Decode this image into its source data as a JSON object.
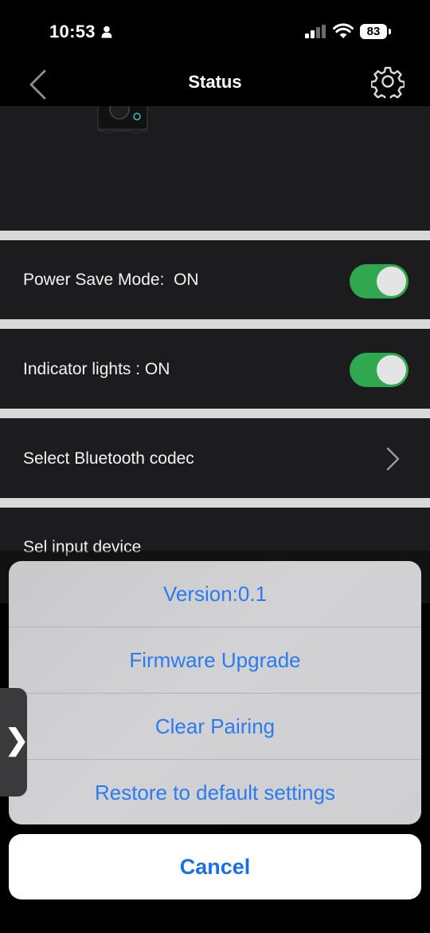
{
  "status_bar": {
    "time": "10:53",
    "battery": "83"
  },
  "nav": {
    "title": "Status"
  },
  "settings": {
    "power_save": {
      "label": "Power Save Mode:  ON",
      "on": true
    },
    "indicator_lights": {
      "label": "Indicator lights : ON",
      "on": true
    },
    "bluetooth_codec": {
      "label": "Select Bluetooth codec"
    },
    "input_device": {
      "label": "Sel input device"
    }
  },
  "action_sheet": {
    "items": [
      "Version:0.1",
      "Firmware Upgrade",
      "Clear Pairing",
      "Restore to default settings"
    ],
    "cancel": "Cancel"
  },
  "side_handle": {
    "glyph": "❯"
  },
  "colors": {
    "toggle_on": "#2fa84f",
    "action_text": "#2a7bf0",
    "background": "#000000",
    "row_bg": "#1c1c1e"
  }
}
